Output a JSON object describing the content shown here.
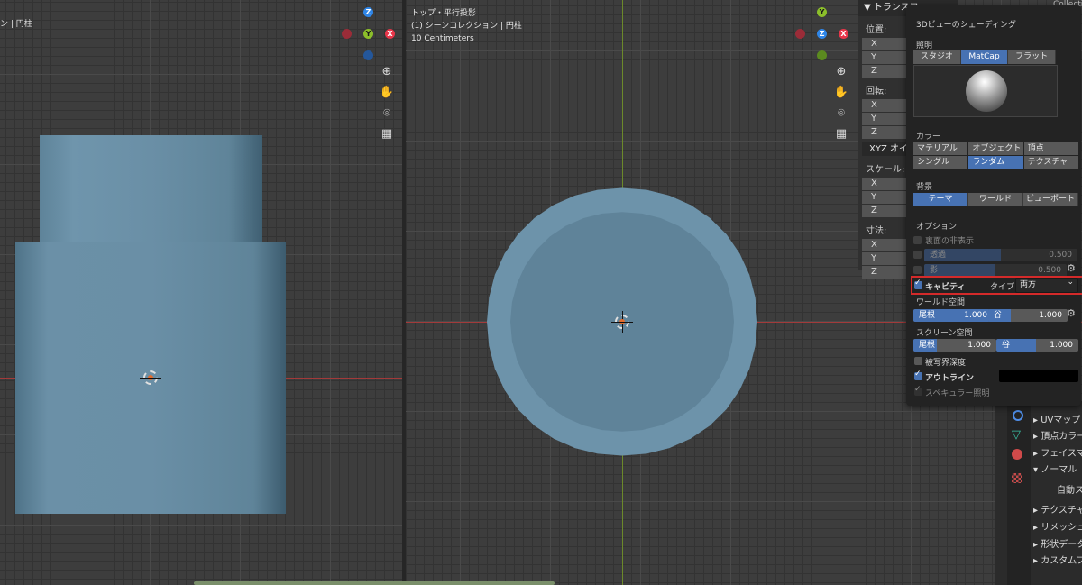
{
  "left_viewport": {
    "info_line1": "ン | 円柱"
  },
  "right_viewport": {
    "view_name": "トップ・平行投影",
    "collection_line": "(1) シーンコレクション | 円柱",
    "scale_line": "10 Centimeters"
  },
  "gizmo": {
    "z": "Z",
    "y": "Y",
    "x": "X"
  },
  "nav_icons": [
    "zoom-icon",
    "hand-icon",
    "camera-icon",
    "grid-icon"
  ],
  "npanel": {
    "header": "▼ トランスフ",
    "location": "位置:",
    "rotation": "回転:",
    "rotation_mode": "XYZ オイラ",
    "scale": "スケール:",
    "dimensions": "寸法:",
    "x": "X",
    "y": "Y",
    "z": "Z"
  },
  "shading": {
    "title": "3Dビューのシェーディング",
    "lighting_label": "照明",
    "lighting_options": [
      "スタジオ",
      "MatCap",
      "フラット"
    ],
    "lighting_selected": 1,
    "color_label": "カラー",
    "color_options": [
      "マテリアル",
      "オブジェクト",
      "頂点",
      "シングル",
      "ランダム",
      "テクスチャ"
    ],
    "color_selected": 4,
    "background_label": "背景",
    "background_options": [
      "テーマ",
      "ワールド",
      "ビューポート"
    ],
    "background_selected": 0,
    "options_label": "オプション",
    "backface_label": "裏面の非表示",
    "xray_label": "透過",
    "xray_value": "0.500",
    "shadow_label": "影",
    "shadow_value": "0.500",
    "cavity_label": "キャビティ",
    "type_label": "タイプ:",
    "type_value": "両方",
    "world_space_label": "ワールド空間",
    "world_ridge_label": "尾根",
    "world_ridge_value": "1.000",
    "world_valley_label": "谷",
    "world_valley_value": "1.000",
    "screen_space_label": "スクリーン空間",
    "screen_ridge_label": "尾根",
    "screen_ridge_value": "1.000",
    "screen_valley_label": "谷",
    "screen_valley_value": "1.000",
    "dof_label": "被写界深度",
    "outline_label": "アウトライン",
    "specular_label": "スペキュラー照明"
  },
  "properties": {
    "items": [
      "▸ UVマップ",
      "▸ 頂点カラー",
      "▸ フェイスマ",
      "▾ ノーマル",
      "自動ス",
      "▸ テクスチャ",
      "▸ リメッシュ",
      "▸ 形状データ",
      "▸ カスタムプ"
    ]
  },
  "top_right": {
    "label": "Collecti"
  },
  "colors": {
    "accent": "#4772b3",
    "object": "#6b8fa6",
    "x_axis": "#e8364a",
    "y_axis": "#8cbf2a",
    "z_axis": "#2f86e8",
    "highlight": "#d42a2a"
  }
}
